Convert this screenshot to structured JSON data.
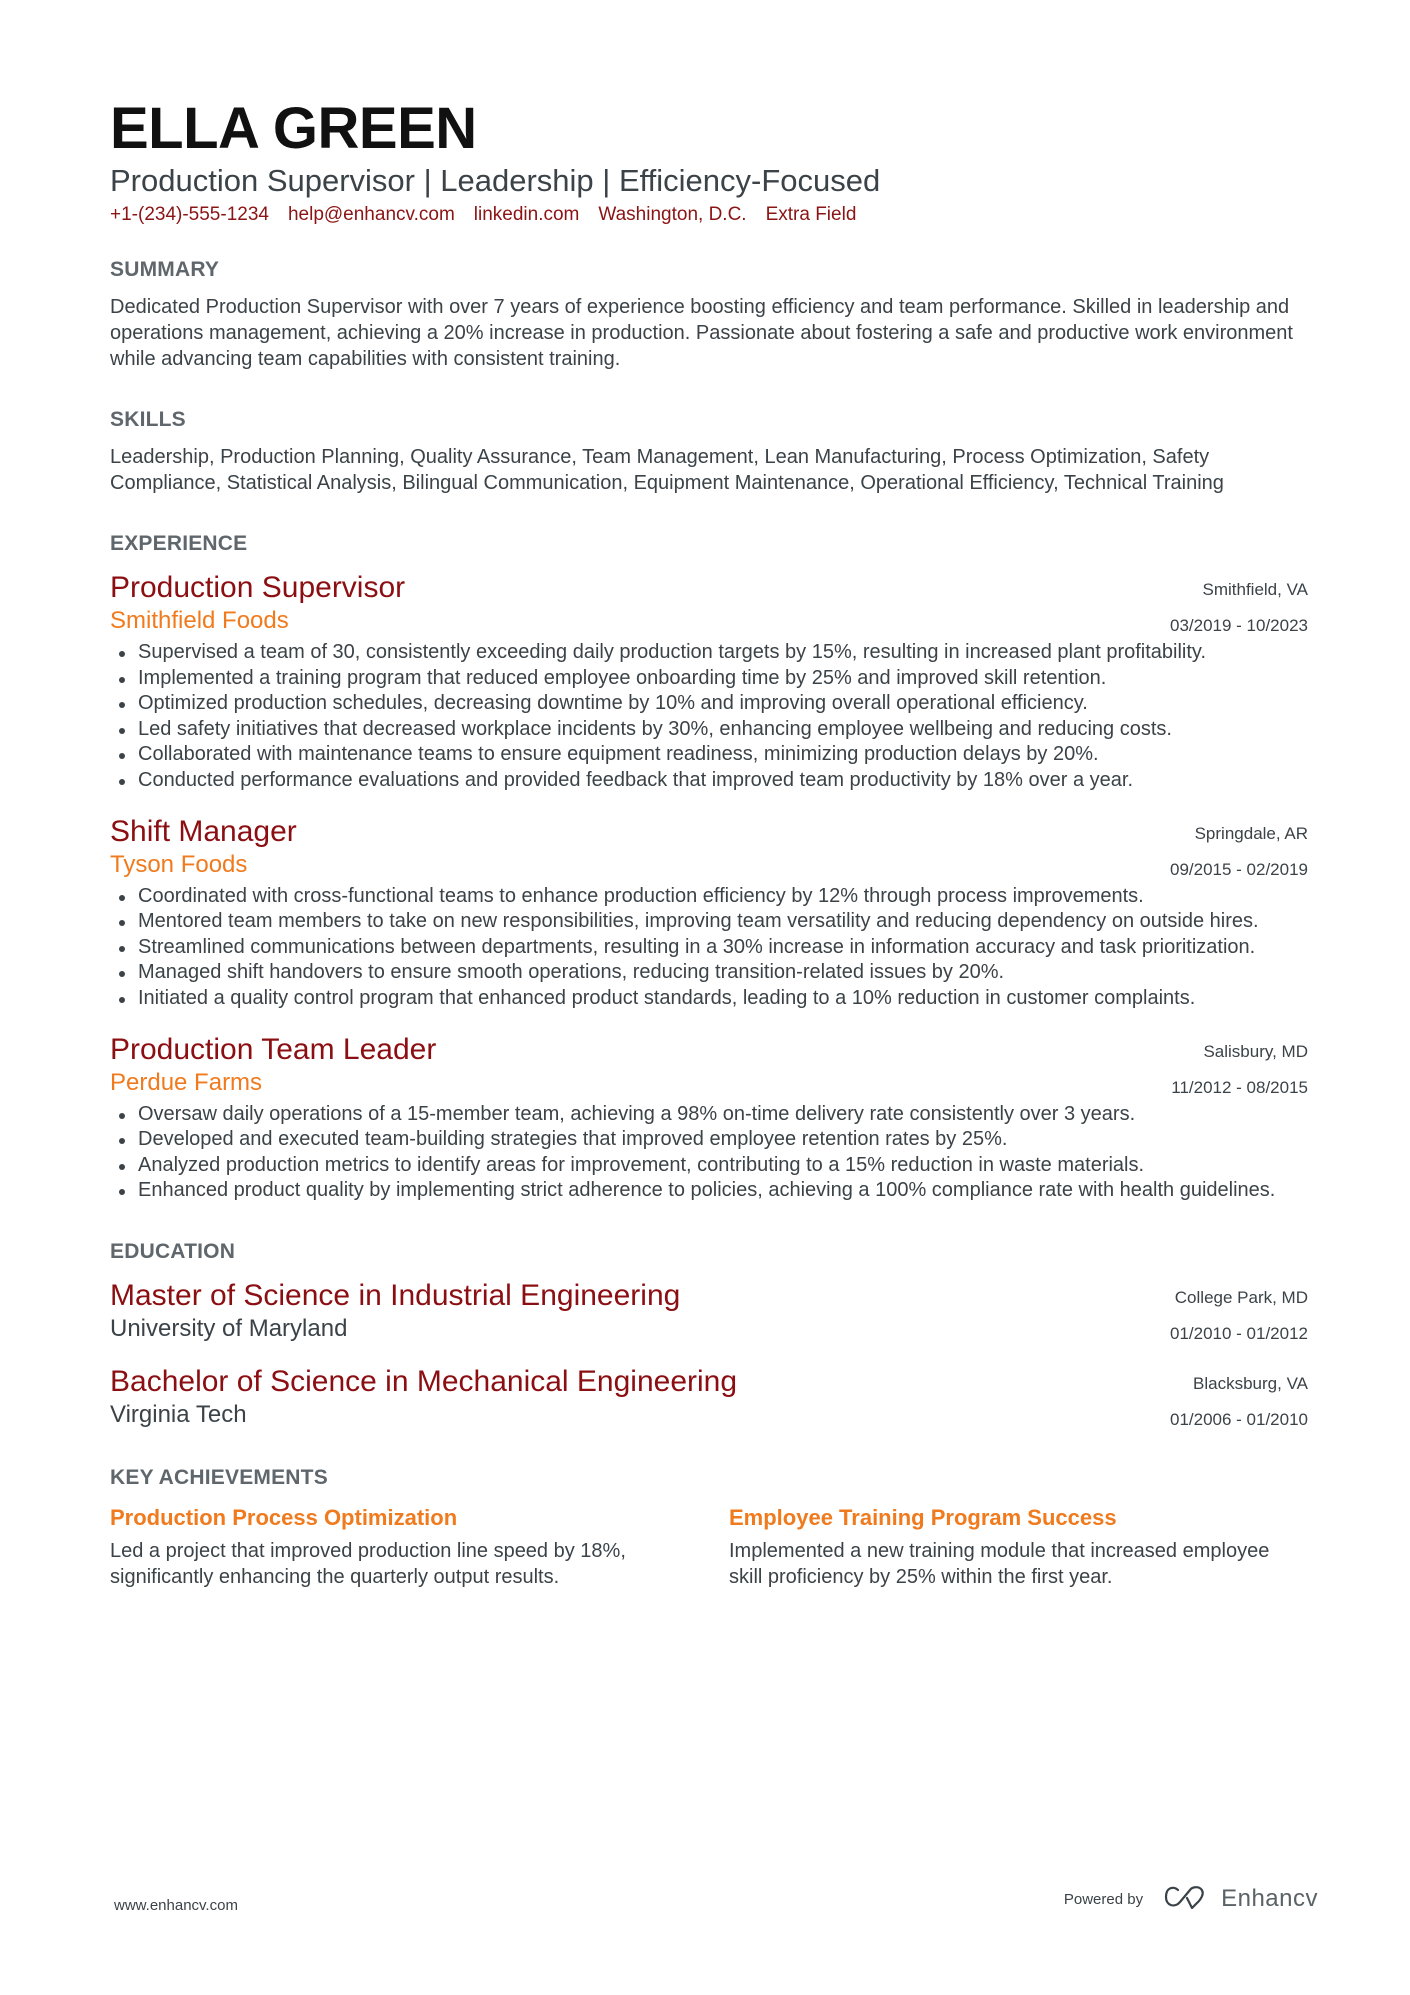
{
  "header": {
    "name": "ELLA GREEN",
    "headline": "Production Supervisor | Leadership | Efficiency-Focused",
    "contacts": [
      "+1-(234)-555-1234",
      "help@enhancv.com",
      "linkedin.com",
      "Washington, D.C.",
      "Extra Field"
    ]
  },
  "summary": {
    "title": "SUMMARY",
    "text": "Dedicated Production Supervisor with over 7 years of experience boosting efficiency and team performance. Skilled in leadership and operations management, achieving a 20% increase in production. Passionate about fostering a safe and productive work environment while advancing team capabilities with consistent training."
  },
  "skills": {
    "title": "SKILLS",
    "text": "Leadership, Production Planning, Quality Assurance, Team Management, Lean Manufacturing, Process Optimization, Safety Compliance, Statistical Analysis, Bilingual Communication, Equipment Maintenance, Operational Efficiency, Technical Training"
  },
  "experience": {
    "title": "EXPERIENCE",
    "items": [
      {
        "role": "Production Supervisor",
        "company": "Smithfield Foods",
        "location": "Smithfield, VA",
        "dates": "03/2019 - 10/2023",
        "bullets": [
          "Supervised a team of 30, consistently exceeding daily production targets by 15%, resulting in increased plant profitability.",
          "Implemented a training program that reduced employee onboarding time by 25% and improved skill retention.",
          "Optimized production schedules, decreasing downtime by 10% and improving overall operational efficiency.",
          "Led safety initiatives that decreased workplace incidents by 30%, enhancing employee wellbeing and reducing costs.",
          "Collaborated with maintenance teams to ensure equipment readiness, minimizing production delays by 20%.",
          "Conducted performance evaluations and provided feedback that improved team productivity by 18% over a year."
        ]
      },
      {
        "role": "Shift Manager",
        "company": "Tyson Foods",
        "location": "Springdale, AR",
        "dates": "09/2015 - 02/2019",
        "bullets": [
          "Coordinated with cross-functional teams to enhance production efficiency by 12% through process improvements.",
          "Mentored team members to take on new responsibilities, improving team versatility and reducing dependency on outside hires.",
          "Streamlined communications between departments, resulting in a 30% increase in information accuracy and task prioritization.",
          "Managed shift handovers to ensure smooth operations, reducing transition-related issues by 20%.",
          "Initiated a quality control program that enhanced product standards, leading to a 10% reduction in customer complaints."
        ]
      },
      {
        "role": "Production Team Leader",
        "company": "Perdue Farms",
        "location": "Salisbury, MD",
        "dates": "11/2012 - 08/2015",
        "bullets": [
          "Oversaw daily operations of a 15-member team, achieving a 98% on-time delivery rate consistently over 3 years.",
          "Developed and executed team-building strategies that improved employee retention rates by 25%.",
          "Analyzed production metrics to identify areas for improvement, contributing to a 15% reduction in waste materials.",
          "Enhanced product quality by implementing strict adherence to policies, achieving a 100% compliance rate with health guidelines."
        ]
      }
    ]
  },
  "education": {
    "title": "EDUCATION",
    "items": [
      {
        "degree": "Master of Science in Industrial Engineering",
        "school": "University of Maryland",
        "location": "College Park, MD",
        "dates": "01/2010 - 01/2012"
      },
      {
        "degree": "Bachelor of Science in Mechanical Engineering",
        "school": "Virginia Tech",
        "location": "Blacksburg, VA",
        "dates": "01/2006 - 01/2010"
      }
    ]
  },
  "achievements": {
    "title": "KEY ACHIEVEMENTS",
    "items": [
      {
        "title": "Production Process Optimization",
        "description": "Led a project that improved production line speed by 18%, significantly enhancing the quarterly output results."
      },
      {
        "title": "Employee Training Program Success",
        "description": "Implemented a new training module that increased employee skill proficiency by 25% within the first year."
      }
    ]
  },
  "footer": {
    "website": "www.enhancv.com",
    "powered_by": "Powered by",
    "brand_name": "Enhancv",
    "brand_icon": "enhancv-logo-icon"
  },
  "colors": {
    "accent_dark_red": "#8b0f12",
    "accent_orange": "#f07b1e",
    "contact_red": "#8b1414",
    "section_title_gray": "#5f676c",
    "body_text": "#3b4348"
  }
}
